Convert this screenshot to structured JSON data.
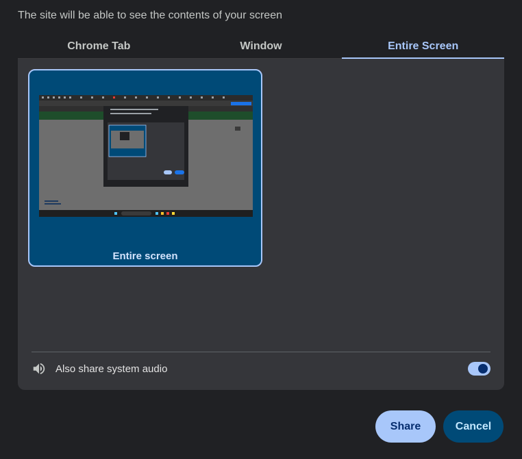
{
  "dialog": {
    "subtitle": "The site will be able to see the contents of your screen"
  },
  "tabs": [
    {
      "label": "Chrome Tab"
    },
    {
      "label": "Window"
    },
    {
      "label": "Entire Screen"
    }
  ],
  "screens": [
    {
      "label": "Entire screen"
    }
  ],
  "audio": {
    "label": "Also share system audio",
    "icon": "speaker-icon",
    "enabled": true
  },
  "buttons": {
    "share": "Share",
    "cancel": "Cancel"
  },
  "colors": {
    "accent": "#a8c7fa",
    "selected_card": "#004a77",
    "panel": "#35363a",
    "background": "#202124"
  }
}
